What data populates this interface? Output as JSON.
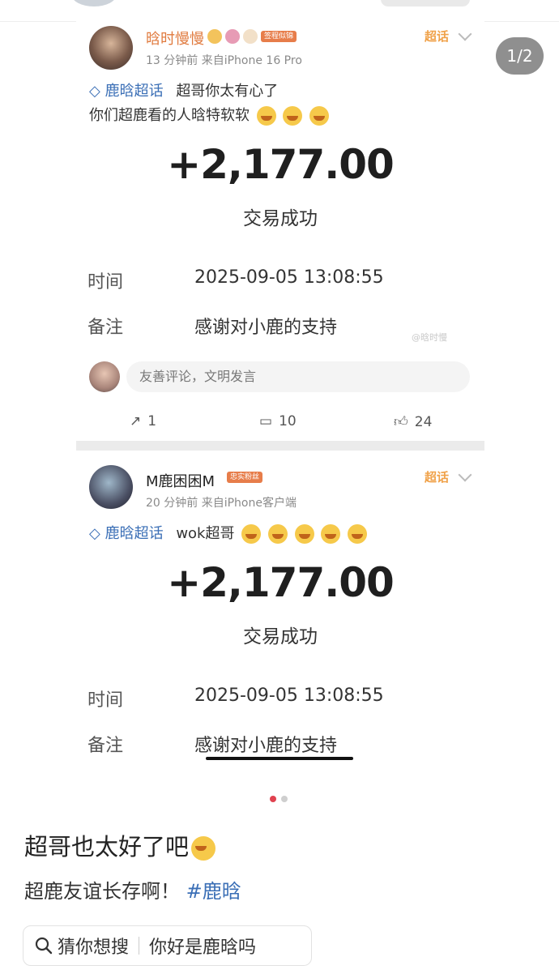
{
  "pager": {
    "counter": "1/2"
  },
  "posts": [
    {
      "username": "晗时慢慢",
      "badge": "签程似锦",
      "meta": "13 分钟前  来自iPhone 16 Pro",
      "chaohua_label": "超话",
      "tag": "鹿晗超话",
      "text_line1": "超哥你太有心了",
      "text_line2": "你们超鹿看的人晗特软软",
      "amount": "+2,177.00",
      "status": "交易成功",
      "row1_label": "时间",
      "row1_value": "2025-09-05 13:08:55",
      "row2_label": "备注",
      "row2_value": "感谢对小鹿的支持",
      "watermark": "@晗时慢",
      "comment_placeholder": "友善评论，文明发言",
      "shares": "1",
      "comments": "10",
      "likes": "24"
    },
    {
      "username": "M鹿困困M",
      "badge": "忠实粉丝",
      "meta": "20 分钟前  来自iPhone客户端",
      "chaohua_label": "超话",
      "tag": "鹿晗超话",
      "text_line1": "wok超哥",
      "amount": "+2,177.00",
      "status": "交易成功",
      "row1_label": "时间",
      "row1_value": "2025-09-05 13:08:55",
      "row2_label": "备注",
      "row2_value": "感谢对小鹿的支持"
    }
  ],
  "caption": {
    "line1": "超哥也太好了吧",
    "line2_prefix": "超鹿友谊长存啊！",
    "hashtag": "#鹿晗"
  },
  "search": {
    "label": "猜你想搜",
    "suggestion": "你好是鹿晗吗"
  },
  "colors": {
    "accent_orange": "#e77d4a",
    "link_blue": "#3b6fb6",
    "dot_active": "#e0424f",
    "dot_inactive": "#cfcfcf"
  }
}
